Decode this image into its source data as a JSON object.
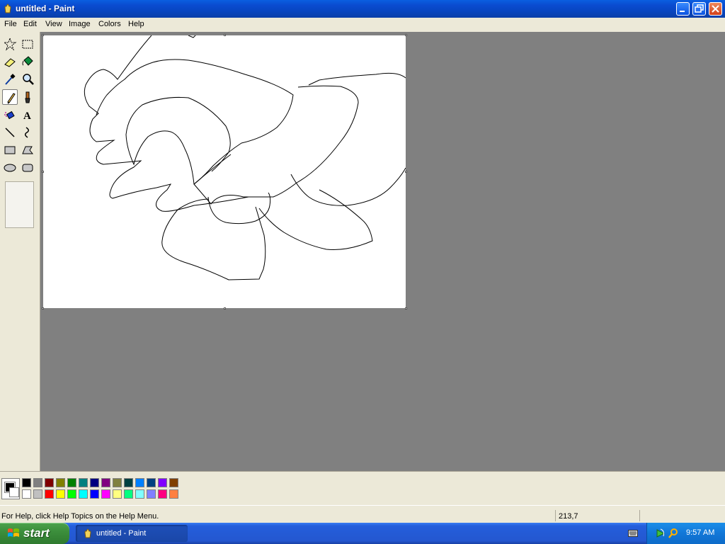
{
  "window": {
    "title": "untitled - Paint",
    "buttons": [
      "minimize",
      "maximize",
      "close"
    ]
  },
  "menu": [
    "File",
    "Edit",
    "View",
    "Image",
    "Colors",
    "Help"
  ],
  "tools": [
    {
      "name": "free-form-select",
      "icon": "star-select-icon"
    },
    {
      "name": "select",
      "icon": "rect-select-icon"
    },
    {
      "name": "eraser",
      "icon": "eraser-icon"
    },
    {
      "name": "fill",
      "icon": "paint-bucket-icon"
    },
    {
      "name": "pick-color",
      "icon": "eyedropper-icon"
    },
    {
      "name": "magnifier",
      "icon": "magnifier-icon"
    },
    {
      "name": "pencil",
      "icon": "pencil-icon",
      "active": true
    },
    {
      "name": "brush",
      "icon": "brush-icon"
    },
    {
      "name": "airbrush",
      "icon": "airbrush-icon"
    },
    {
      "name": "text",
      "icon": "text-icon"
    },
    {
      "name": "line",
      "icon": "line-icon"
    },
    {
      "name": "curve",
      "icon": "curve-icon"
    },
    {
      "name": "rectangle",
      "icon": "rectangle-icon"
    },
    {
      "name": "polygon",
      "icon": "polygon-icon"
    },
    {
      "name": "ellipse",
      "icon": "ellipse-icon"
    },
    {
      "name": "rounded-rectangle",
      "icon": "rounded-rect-icon"
    }
  ],
  "palette": {
    "primary": "#000000",
    "secondary": "#ffffff",
    "top_row": [
      "#000000",
      "#808080",
      "#800000",
      "#808000",
      "#008000",
      "#008080",
      "#000080",
      "#800080",
      "#808040",
      "#004040",
      "#0080ff",
      "#004080",
      "#8000ff",
      "#804000"
    ],
    "bottom_row": [
      "#ffffff",
      "#c0c0c0",
      "#ff0000",
      "#ffff00",
      "#00ff00",
      "#00ffff",
      "#0000ff",
      "#ff00ff",
      "#ffff80",
      "#00ff80",
      "#80ffff",
      "#8080ff",
      "#ff0080",
      "#ff8040"
    ]
  },
  "status": {
    "help_text": "For Help, click Help Topics on the Help Menu.",
    "coords": "213,7"
  },
  "taskbar": {
    "start_label": "start",
    "task_label": "untitled - Paint",
    "clock": "9:57 AM"
  }
}
